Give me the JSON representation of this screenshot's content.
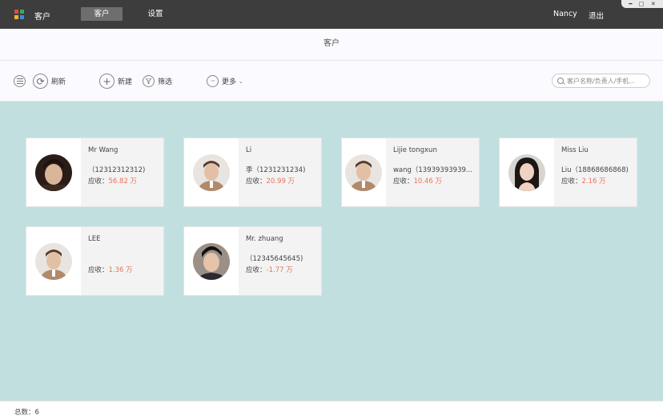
{
  "app": {
    "title": "客户",
    "logo_colors": [
      "#e24c3c",
      "#3aaa5c",
      "#f2b52c",
      "#3c8be0"
    ]
  },
  "nav": {
    "tabs": [
      {
        "label": "客户",
        "active": true
      },
      {
        "label": "设置",
        "active": false
      }
    ],
    "user": "Nancy",
    "logout": "退出"
  },
  "window_controls": {
    "minimize": "━",
    "maximize": "□",
    "close": "✕"
  },
  "page": {
    "title": "客户"
  },
  "toolbar": {
    "menu_icon": "menu-icon",
    "refresh": "刷新",
    "new": "新建",
    "filter": "筛选",
    "more": "更多"
  },
  "search": {
    "placeholder": "客户名称/负责人/手机..."
  },
  "customers": [
    {
      "name": "Mr Wang",
      "phone": "（12312312312)",
      "receivable_label": "应收：",
      "receivable": "56.82 万",
      "avatar": "dark"
    },
    {
      "name": "Li",
      "phone": "李（1231231234)",
      "receivable_label": "应收：",
      "receivable": "20.99 万",
      "avatar": "light"
    },
    {
      "name": "Lijie tongxun",
      "phone": "wang（13939393939...",
      "receivable_label": "应收：",
      "receivable": "10.46 万",
      "avatar": "light"
    },
    {
      "name": "Miss Liu",
      "phone": "Liu（18868686868)",
      "receivable_label": "应收：",
      "receivable": "2.16 万",
      "avatar": "female"
    },
    {
      "name": "LEE",
      "phone": "",
      "receivable_label": "应收：",
      "receivable": "1.36 万",
      "avatar": "light"
    },
    {
      "name": "Mr. zhuang",
      "phone": "（12345645645)",
      "receivable_label": "应收：",
      "receivable": "-1.77 万",
      "avatar": "dark2"
    }
  ],
  "footer": {
    "total": "总数：6"
  },
  "colors": {
    "accent_amount": "#e8735a",
    "content_bg": "#c2dfe0",
    "topbar_bg": "#3d3d3d"
  }
}
